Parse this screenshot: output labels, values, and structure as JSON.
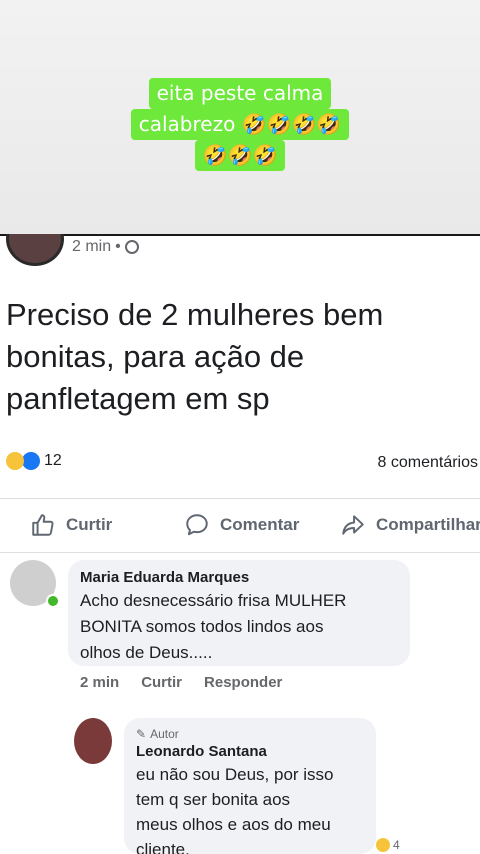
{
  "caption": {
    "lines": [
      "eita peste calma",
      "calabrezo 🤣🤣🤣🤣",
      "🤣🤣🤣"
    ],
    "highlight_color": "#6ee83a"
  },
  "post": {
    "time": "2 min",
    "separator": "•",
    "text": "Preciso de 2 mulheres bem bonitas, para ação de panfletagem em sp",
    "reaction_count": "12",
    "comments_count": "8 comentários"
  },
  "actions": {
    "like": "Curtir",
    "comment": "Comentar",
    "share": "Compartilhar"
  },
  "comments": [
    {
      "name": "Maria Eduarda Marques",
      "text_lines": [
        "Acho desnecessário frisa MULHER",
        "BONITA somos todos lindos aos",
        "olhos de Deus....."
      ],
      "time": "2 min",
      "like": "Curtir",
      "reply": "Responder"
    },
    {
      "author_tag": "Autor",
      "name": "Leonardo Santana",
      "text_lines": [
        "eu não sou Deus, por isso",
        "tem q ser bonita aos",
        "meus olhos e aos do meu",
        "cliente."
      ],
      "reaction_count": "4"
    }
  ]
}
